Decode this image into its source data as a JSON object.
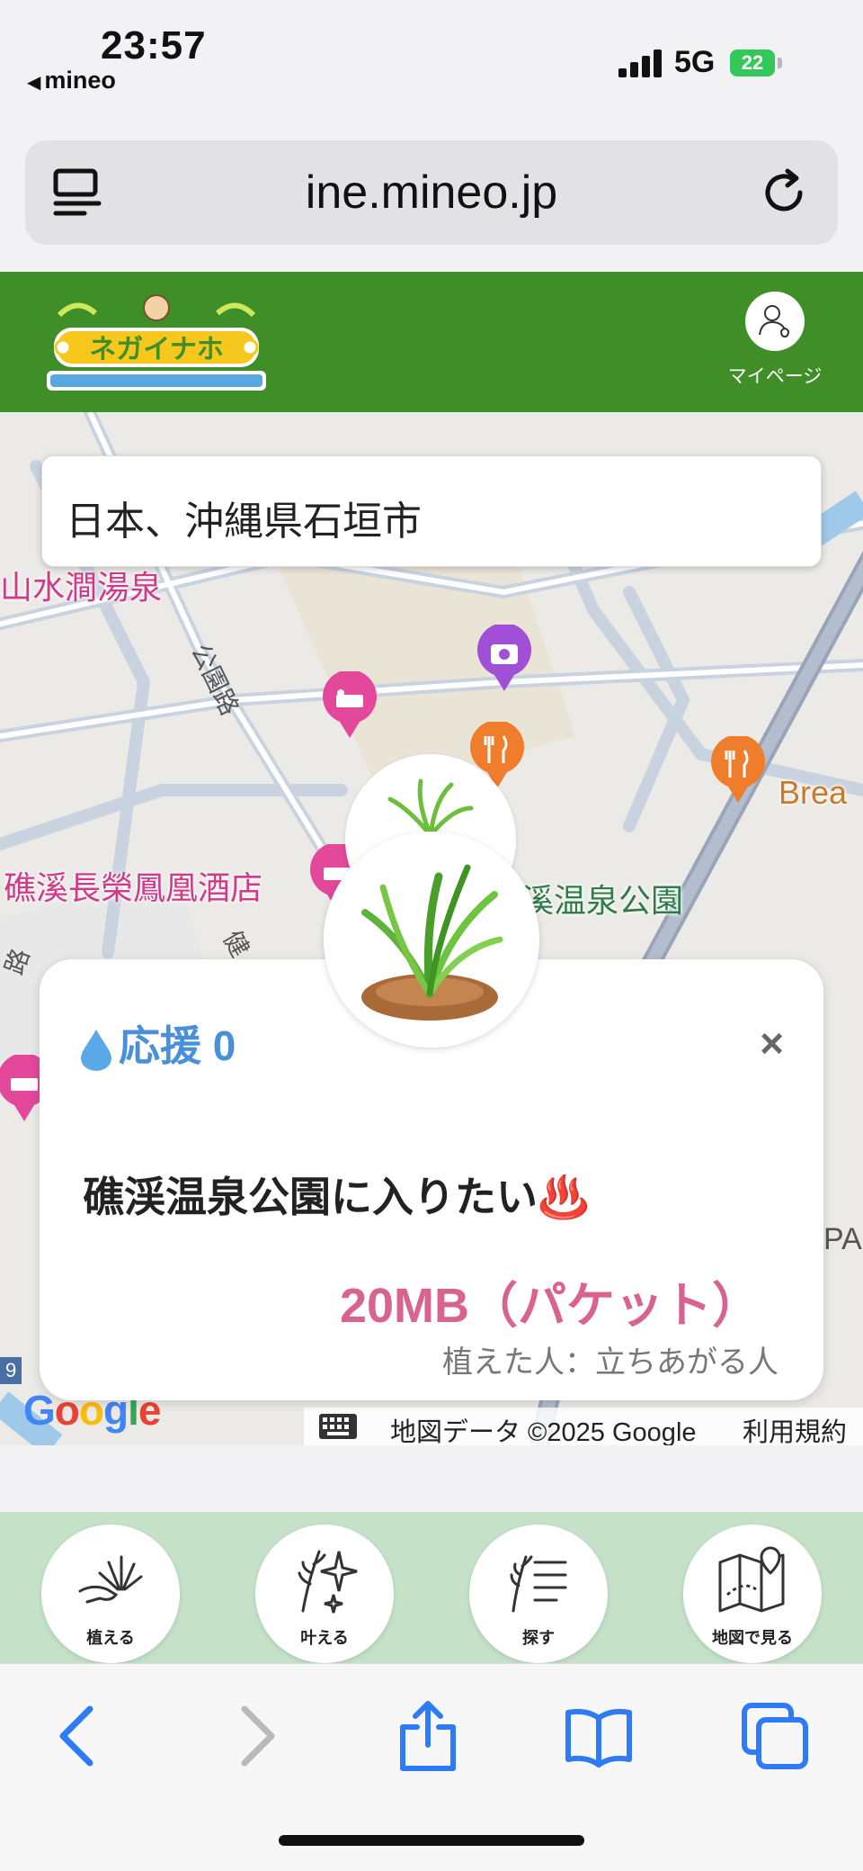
{
  "status_bar": {
    "time": "23:57",
    "back_app": "mineo",
    "network": "5G",
    "battery": "22"
  },
  "url_bar": {
    "url": "ine.mineo.jp",
    "left_icon": "tabs-menu-icon",
    "right_icon": "reload-icon"
  },
  "header": {
    "logo_alt": "ネガイナホ",
    "mypage_label": "マイページ"
  },
  "map": {
    "search_value": "日本、沖縄県石垣市",
    "labels": {
      "hot_spring": "山水澗湯泉",
      "road_park": "公園路",
      "hotel": "礁溪長榮鳳凰酒店",
      "park": "溪温泉公園",
      "bread": "Brea",
      "road_left": "路",
      "road_jian": "健",
      "pa": "PA",
      "route_num": "9"
    },
    "google": "Google",
    "copyright": "地図データ ©2025 Google",
    "terms": "利用規約"
  },
  "card": {
    "support_label": "応援 0",
    "close": "×",
    "wish_text": "礁渓温泉公園に入りたい♨️",
    "reward": "20MB（パケット）",
    "planter": "植えた人：立ちあがる人"
  },
  "bottom_nav": {
    "items": [
      {
        "label": "植える",
        "icon": "plant-hand-icon"
      },
      {
        "label": "叶える",
        "icon": "sparkle-wheat-icon"
      },
      {
        "label": "探す",
        "icon": "search-list-icon"
      },
      {
        "label": "地図で見る",
        "icon": "map-pin-icon"
      }
    ]
  },
  "colors": {
    "header_green": "#3f8e27",
    "nav_bg": "#c5e2c8",
    "support_blue": "#4a90d9",
    "reward_pink": "#d9638f",
    "safari_blue": "#2f7bf5"
  }
}
